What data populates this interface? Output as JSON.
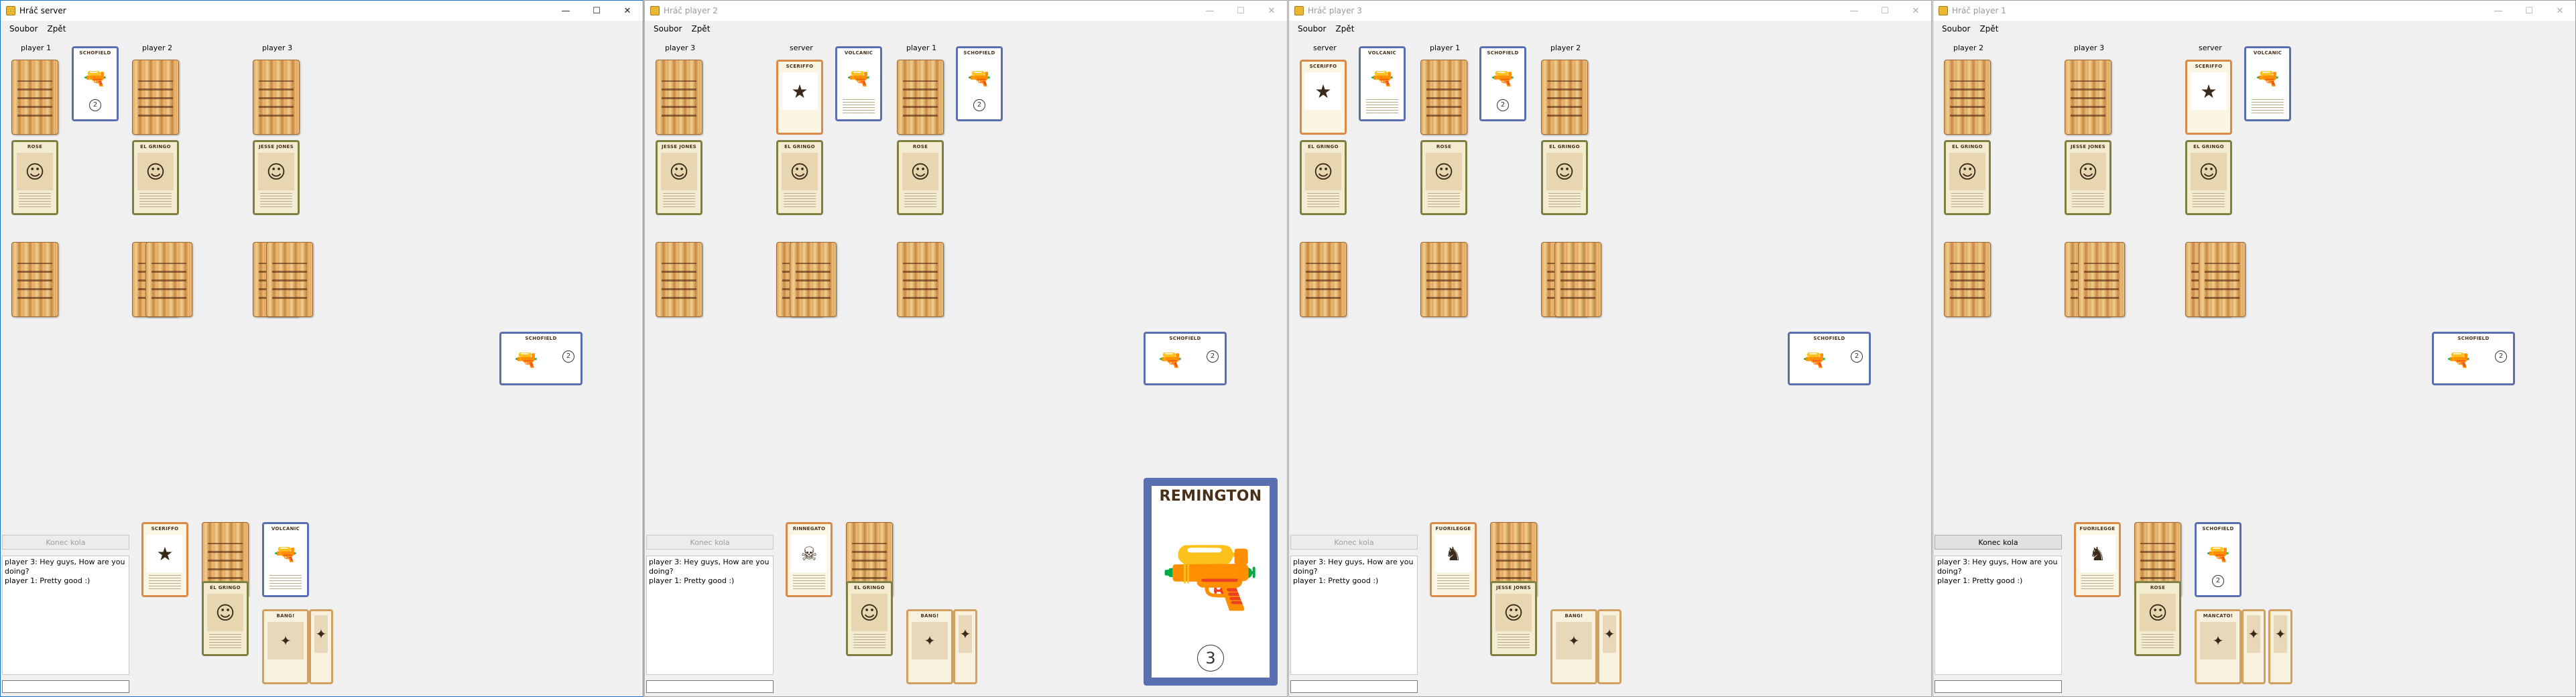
{
  "menu": {
    "file": "Soubor",
    "back": "Zpět"
  },
  "controls": {
    "minimize": "—",
    "maximize": "☐",
    "close": "✕"
  },
  "end_turn": "Konec kola",
  "chat": [
    "player 3: Hey guys, How are you doing?",
    "player 1: Pretty good :)"
  ],
  "cards": {
    "schofield": "SCHOFIELD",
    "volcanic": "VOLCANIC",
    "sceriffo": "SCERIFFO",
    "rinnegato": "RINNEGATO",
    "fuorilegge": "FUORILEGGE",
    "remington": "REMINGTON",
    "rose_doolan": "ROSE DOOLAN",
    "el_gringo": "EL GRINGO",
    "jesse_jones": "JESSE JONES",
    "bang": "BANG!",
    "mancato": "MANCATO!"
  },
  "windows": [
    {
      "title": "Hráč server",
      "active": true,
      "end_turn_enabled": false,
      "players": [
        "player 1",
        "player 2",
        "player 3"
      ],
      "schofield_range": "2",
      "discard_range": "2"
    },
    {
      "title": "Hráč player 2",
      "active": false,
      "end_turn_enabled": false,
      "players": [
        "player 3",
        "server",
        "player 1"
      ],
      "schofield_range": "2",
      "discard_range": "2",
      "remington_range": "3"
    },
    {
      "title": "Hráč player 3",
      "active": false,
      "end_turn_enabled": false,
      "players": [
        "server",
        "player 1",
        "player 2"
      ],
      "schofield_range": "2",
      "discard_range": "2"
    },
    {
      "title": "Hráč player 1",
      "active": false,
      "end_turn_enabled": true,
      "players": [
        "player 2",
        "player 3",
        "server"
      ],
      "schofield_range": "2",
      "discard_range": "2"
    }
  ]
}
